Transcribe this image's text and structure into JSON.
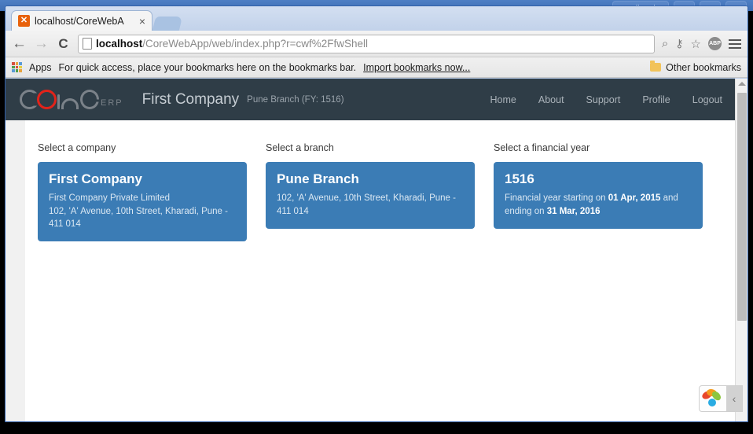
{
  "os": {
    "user_button_label": "dinesh",
    "minimize_label": "–",
    "maximize_label": "□",
    "close_label": "×"
  },
  "browser": {
    "tab": {
      "title": "localhost/CoreWebA",
      "favicon_name": "xampp-favicon",
      "favicon_glyph": "✕",
      "close_label": "×"
    },
    "new_tab_label": "",
    "toolbar": {
      "back_label": "←",
      "forward_label": "→",
      "reload_label": "C",
      "url_prefix": "localhost",
      "url_rest": "/CoreWebApp/web/index.php?r=cwf%2FfwShell",
      "zoom_icon_label": "⌕",
      "key_icon_label": "⚷",
      "star_icon_label": "☆",
      "adblock_label": "ABP",
      "menu_label": "≡"
    },
    "bookmarks": {
      "apps_label": "Apps",
      "hint": "For quick access, place your bookmarks here on the bookmarks bar.",
      "import_link": "Import bookmarks now...",
      "other_bookmarks": "Other bookmarks"
    }
  },
  "app": {
    "logo_text": "core",
    "logo_suffix": "ERP",
    "company_name": "First Company",
    "context": "Pune Branch (FY: 1516)",
    "nav": [
      {
        "label": "Home"
      },
      {
        "label": "About"
      },
      {
        "label": "Support"
      },
      {
        "label": "Profile"
      },
      {
        "label": "Logout"
      }
    ]
  },
  "main": {
    "columns": [
      {
        "label": "Select a company",
        "card": {
          "title": "First Company",
          "lines": [
            {
              "text": "First Company Private Limited"
            },
            {
              "text": "102, 'A' Avenue, 10th Street, Kharadi, Pune - 411 014"
            }
          ]
        }
      },
      {
        "label": "Select a branch",
        "card": {
          "title": "Pune Branch",
          "lines": [
            {
              "text": "102, 'A' Avenue, 10th Street, Kharadi, Pune - 411 014"
            }
          ]
        }
      },
      {
        "label": "Select a financial year",
        "card": {
          "title": "1516",
          "fy_prefix": "Financial year starting on ",
          "fy_start": "01 Apr, 2015",
          "fy_middle": " and ending on ",
          "fy_end": "31 Mar, 2016"
        }
      }
    ]
  },
  "widget": {
    "name": "helper-widget",
    "collapse_label": "‹"
  },
  "colors": {
    "card_blue": "#3b7cb5",
    "header_dark": "#2f3d47",
    "logo_red": "#e2231a",
    "os_blue": "#4e7fc4"
  }
}
